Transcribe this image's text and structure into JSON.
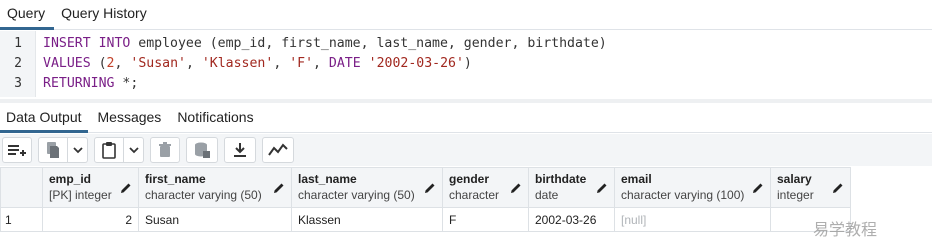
{
  "query_tabs": [
    {
      "label": "Query",
      "active": true
    },
    {
      "label": "Query History",
      "active": false
    }
  ],
  "editor": {
    "lines": [
      {
        "num": "1",
        "tokens": [
          {
            "t": "kw",
            "v": "INSERT INTO"
          },
          {
            "t": "ident",
            "v": " employee (emp_id, first_name, last_name, gender, birthdate)"
          }
        ]
      },
      {
        "num": "2",
        "tokens": [
          {
            "t": "kw",
            "v": "VALUES"
          },
          {
            "t": "ident",
            "v": " ("
          },
          {
            "t": "num",
            "v": "2"
          },
          {
            "t": "ident",
            "v": ", "
          },
          {
            "t": "str",
            "v": "'Susan'"
          },
          {
            "t": "ident",
            "v": ", "
          },
          {
            "t": "str",
            "v": "'Klassen'"
          },
          {
            "t": "ident",
            "v": ", "
          },
          {
            "t": "str",
            "v": "'F'"
          },
          {
            "t": "ident",
            "v": ", "
          },
          {
            "t": "kw",
            "v": "DATE"
          },
          {
            "t": "ident",
            "v": " "
          },
          {
            "t": "str",
            "v": "'2002-03-26'"
          },
          {
            "t": "ident",
            "v": ")"
          }
        ]
      },
      {
        "num": "3",
        "tokens": [
          {
            "t": "kw",
            "v": "RETURNING"
          },
          {
            "t": "ident",
            "v": " *;"
          }
        ]
      }
    ]
  },
  "result_tabs": [
    {
      "label": "Data Output",
      "active": true
    },
    {
      "label": "Messages",
      "active": false
    },
    {
      "label": "Notifications",
      "active": false
    }
  ],
  "toolbar": {
    "buttons": [
      "add-row-icon",
      "copy-icon",
      "chevron-down-icon",
      "paste-icon",
      "chevron-down-icon",
      "delete-icon",
      "save-data-icon",
      "download-icon",
      "graph-icon"
    ]
  },
  "grid": {
    "columns": [
      {
        "name": "emp_id",
        "type": "[PK] integer"
      },
      {
        "name": "first_name",
        "type": "character varying (50)"
      },
      {
        "name": "last_name",
        "type": "character varying (50)"
      },
      {
        "name": "gender",
        "type": "character"
      },
      {
        "name": "birthdate",
        "type": "date"
      },
      {
        "name": "email",
        "type": "character varying (100)"
      },
      {
        "name": "salary",
        "type": "integer"
      }
    ],
    "rows": [
      {
        "rownum": "1",
        "cells": [
          "2",
          "Susan",
          "Klassen",
          "F",
          "2002-03-26",
          "[null]",
          ""
        ]
      }
    ]
  },
  "watermark": "易学教程"
}
